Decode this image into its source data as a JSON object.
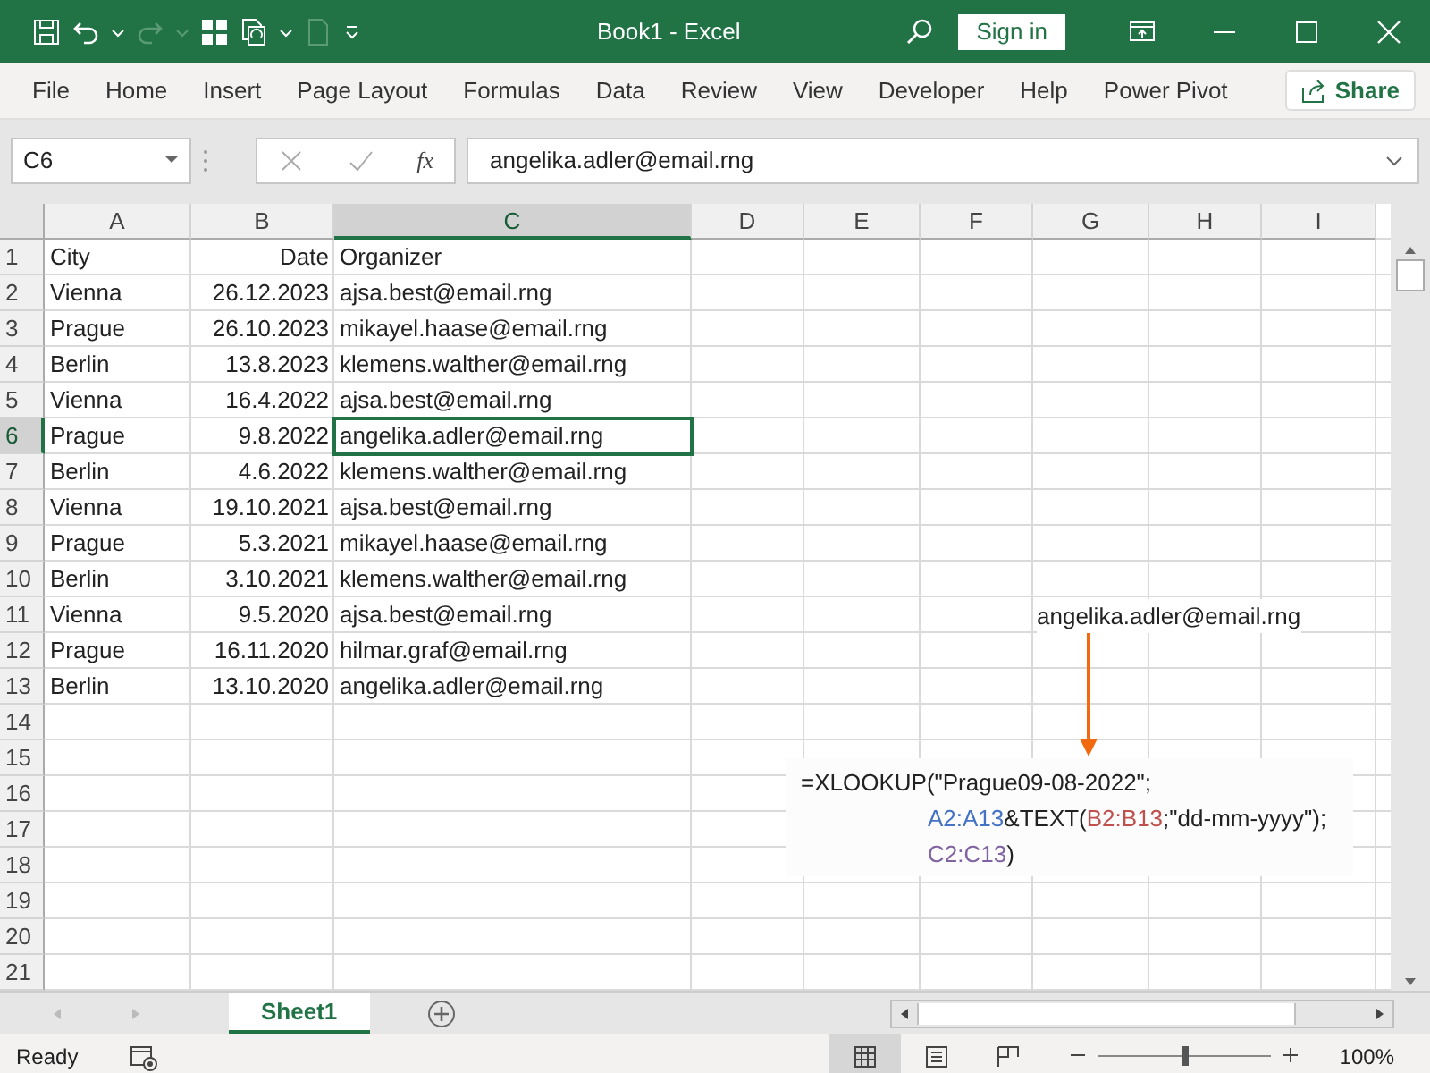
{
  "window": {
    "title": "Book1  -  Excel",
    "sign_in": "Sign in"
  },
  "ribbon": {
    "tabs": [
      {
        "label": "File",
        "selected": false
      },
      {
        "label": "Home",
        "selected": false
      },
      {
        "label": "Insert",
        "selected": false
      },
      {
        "label": "Page Layout",
        "selected": false
      },
      {
        "label": "Formulas",
        "selected": false
      },
      {
        "label": "Data",
        "selected": false
      },
      {
        "label": "Review",
        "selected": false
      },
      {
        "label": "View",
        "selected": false
      },
      {
        "label": "Developer",
        "selected": false
      },
      {
        "label": "Help",
        "selected": false
      },
      {
        "label": "Power Pivot",
        "selected": false
      }
    ],
    "share": "Share"
  },
  "formula_bar": {
    "name_box": "C6",
    "function_button": "fx",
    "value": "angelika.adler@email.rng"
  },
  "sheet": {
    "columns": [
      {
        "label": "A",
        "selected": false
      },
      {
        "label": "B",
        "selected": false
      },
      {
        "label": "C",
        "selected": true
      },
      {
        "label": "D",
        "selected": false
      },
      {
        "label": "E",
        "selected": false
      },
      {
        "label": "F",
        "selected": false
      },
      {
        "label": "G",
        "selected": false
      },
      {
        "label": "H",
        "selected": false
      },
      {
        "label": "I",
        "selected": false
      }
    ],
    "rows": [
      {
        "number": "1",
        "selected": false,
        "cells": [
          "City",
          "Date",
          "Organizer"
        ]
      },
      {
        "number": "2",
        "selected": false,
        "cells": [
          "Vienna",
          "26.12.2023",
          "ajsa.best@email.rng"
        ]
      },
      {
        "number": "3",
        "selected": false,
        "cells": [
          "Prague",
          "26.10.2023",
          "mikayel.haase@email.rng"
        ]
      },
      {
        "number": "4",
        "selected": false,
        "cells": [
          "Berlin",
          "13.8.2023",
          "klemens.walther@email.rng"
        ]
      },
      {
        "number": "5",
        "selected": false,
        "cells": [
          "Vienna",
          "16.4.2022",
          "ajsa.best@email.rng"
        ]
      },
      {
        "number": "6",
        "selected": true,
        "cells": [
          "Prague",
          "9.8.2022",
          "angelika.adler@email.rng"
        ]
      },
      {
        "number": "7",
        "selected": false,
        "cells": [
          "Berlin",
          "4.6.2022",
          "klemens.walther@email.rng"
        ]
      },
      {
        "number": "8",
        "selected": false,
        "cells": [
          "Vienna",
          "19.10.2021",
          "ajsa.best@email.rng"
        ]
      },
      {
        "number": "9",
        "selected": false,
        "cells": [
          "Prague",
          "5.3.2021",
          "mikayel.haase@email.rng"
        ]
      },
      {
        "number": "10",
        "selected": false,
        "cells": [
          "Berlin",
          "3.10.2021",
          "klemens.walther@email.rng"
        ]
      },
      {
        "number": "11",
        "selected": false,
        "cells": [
          "Vienna",
          "9.5.2020",
          "ajsa.best@email.rng"
        ]
      },
      {
        "number": "12",
        "selected": false,
        "cells": [
          "Prague",
          "16.11.2020",
          "hilmar.graf@email.rng"
        ]
      },
      {
        "number": "13",
        "selected": false,
        "cells": [
          "Berlin",
          "13.10.2020",
          "angelika.adler@email.rng"
        ]
      },
      {
        "number": "14",
        "selected": false
      },
      {
        "number": "15",
        "selected": false
      },
      {
        "number": "16",
        "selected": false
      },
      {
        "number": "17",
        "selected": false
      },
      {
        "number": "18",
        "selected": false
      },
      {
        "number": "19",
        "selected": false
      },
      {
        "number": "20",
        "selected": false
      },
      {
        "number": "21",
        "selected": false
      }
    ],
    "result_cell": "angelika.adler@email.rng",
    "formula_note": [
      [
        {
          "text": "=XLOOKUP(\"Prague09-08-2022\";"
        }
      ],
      [
        {
          "text": "A2:A13",
          "color": "#4472c4"
        },
        {
          "text": "&TEXT("
        },
        {
          "text": "B2:B13",
          "color": "#c0504d"
        },
        {
          "text": ";\"dd-mm-yyyy\");"
        }
      ],
      [
        {
          "text": "C2:C13",
          "color": "#8064a2"
        },
        {
          "text": ")"
        }
      ]
    ]
  },
  "sheet_tabs": [
    {
      "label": "Sheet1",
      "selected": true
    }
  ],
  "status_bar": {
    "mode": "Ready",
    "views": [
      {
        "kind": "normal",
        "selected": true
      },
      {
        "kind": "layout",
        "selected": false
      },
      {
        "kind": "pagebreak",
        "selected": false
      }
    ],
    "zoom": {
      "level": 0.5,
      "reading": "100%"
    }
  }
}
